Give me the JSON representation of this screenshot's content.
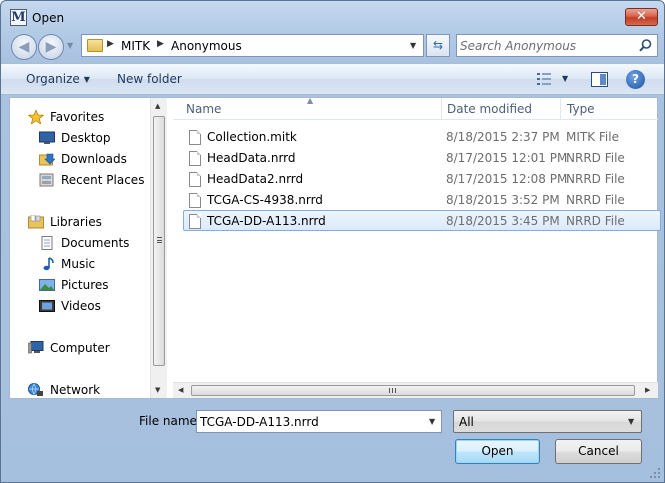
{
  "window": {
    "title": "Open",
    "app_icon_letter": "M",
    "close_glyph": "✕"
  },
  "address": {
    "crumbs": [
      "MITK",
      "Anonymous"
    ],
    "search_placeholder": "Search Anonymous"
  },
  "toolbar": {
    "organize": "Organize",
    "new_folder": "New folder",
    "help": "?"
  },
  "nav": {
    "items": [
      {
        "label": "Favorites",
        "icon": "star-icon"
      },
      {
        "label": "Desktop",
        "icon": "desktop-icon"
      },
      {
        "label": "Downloads",
        "icon": "downloads-icon"
      },
      {
        "label": "Recent Places",
        "icon": "recent-places-icon"
      },
      {
        "label": "Libraries",
        "icon": "libraries-icon"
      },
      {
        "label": "Documents",
        "icon": "documents-icon"
      },
      {
        "label": "Music",
        "icon": "music-icon"
      },
      {
        "label": "Pictures",
        "icon": "pictures-icon"
      },
      {
        "label": "Videos",
        "icon": "videos-icon"
      },
      {
        "label": "Computer",
        "icon": "computer-icon"
      },
      {
        "label": "Network",
        "icon": "network-icon"
      }
    ]
  },
  "files": {
    "columns": [
      "Name",
      "Date modified",
      "Type"
    ],
    "rows": [
      {
        "name": "Collection.mitk",
        "date": "8/18/2015 2:37 PM",
        "type": "MITK File"
      },
      {
        "name": "HeadData.nrrd",
        "date": "8/17/2015 12:01 PM",
        "type": "NRRD File"
      },
      {
        "name": "HeadData2.nrrd",
        "date": "8/17/2015 12:08 PM",
        "type": "NRRD File"
      },
      {
        "name": "TCGA-CS-4938.nrrd",
        "date": "8/18/2015 3:52 PM",
        "type": "NRRD File"
      },
      {
        "name": "TCGA-DD-A113.nrrd",
        "date": "8/18/2015 3:45 PM",
        "type": "NRRD File"
      }
    ],
    "selected_index": 4
  },
  "bottom": {
    "file_name_label": "File name:",
    "file_name_value": "TCGA-DD-A113.nrrd",
    "filter_value": "All",
    "open_label": "Open",
    "cancel_label": "Cancel"
  },
  "colors": {
    "accent": "#3c7fb1",
    "selection": "#84acdd",
    "close": "#c23e26"
  }
}
